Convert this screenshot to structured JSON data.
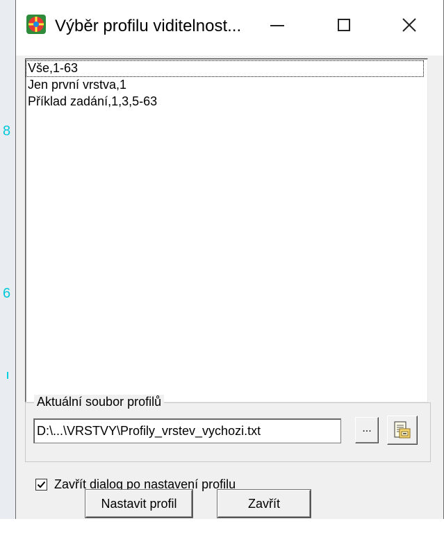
{
  "window": {
    "title": "Výběr profilu viditelnost...",
    "icon": "cad-app-icon"
  },
  "titlebar_buttons": {
    "minimize": "minimize-icon",
    "maximize": "maximize-icon",
    "close": "close-icon"
  },
  "profiles": {
    "items": [
      {
        "label": "Vše,1-63",
        "selected": true
      },
      {
        "label": "Jen první vrstva,1",
        "selected": false
      },
      {
        "label": "Příklad zadání,1,3,5-63",
        "selected": false
      }
    ]
  },
  "current_file": {
    "group_label": "Aktuální soubor profilů",
    "path_value": "D:\\...\\VRSTVY\\Profily_vrstev_vychozi.txt",
    "browse_label": "...",
    "load_icon": "load-file-icon"
  },
  "options": {
    "close_after_set_label": "Zavřít dialog po nastavení profilu",
    "close_after_set_checked": true
  },
  "buttons": {
    "set_profile": "Nastavit profil",
    "close": "Zavřít"
  },
  "colors": {
    "dialog_bg": "#f0f0f0",
    "background_canvas_accent": "#00c8da"
  }
}
